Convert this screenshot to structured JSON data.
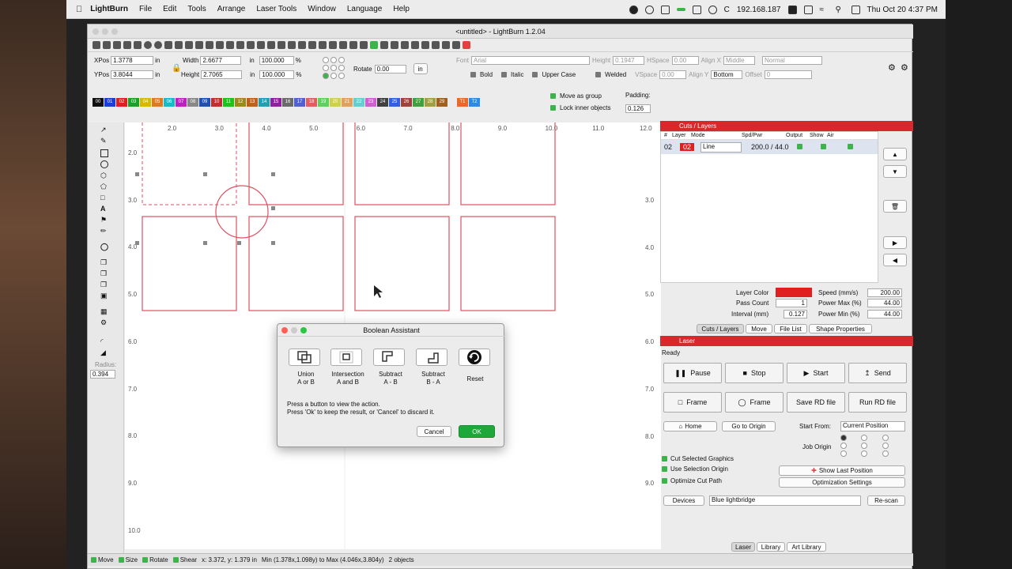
{
  "menubar": {
    "app": "LightBurn",
    "menus": [
      "File",
      "Edit",
      "Tools",
      "Arrange",
      "Laser Tools",
      "Window",
      "Language",
      "Help"
    ],
    "ip": "192.168.187",
    "clock": "Thu Oct 20  4:37 PM"
  },
  "window": {
    "title": "<untitled> - LightBurn 1.2.04"
  },
  "props": {
    "xpos_label": "XPos",
    "xpos": "1.3778",
    "ypos_label": "YPos",
    "ypos": "3.8044",
    "unit": "in",
    "width_label": "Width",
    "width": "2.6677",
    "height_label": "Height",
    "height": "2.7065",
    "scale_w": "100.000",
    "scale_h": "100.000",
    "pct": "%",
    "rotate_label": "Rotate",
    "rotate": "0.00",
    "in_btn": "in"
  },
  "font": {
    "font_label": "Font",
    "font": "Arial",
    "height_label": "Height",
    "height": "0.1947",
    "hspace_label": "HSpace",
    "hspace": "0.00",
    "alignx_label": "Align X",
    "alignx": "Middle",
    "normal": "Normal",
    "bold": "Bold",
    "italic": "Italic",
    "upper": "Upper Case",
    "welded": "Welded",
    "vspace_label": "VSpace",
    "vspace": "0.00",
    "aligny_label": "Align Y",
    "aligny": "Bottom",
    "offset_label": "Offset",
    "offset": "0"
  },
  "palette": [
    "00",
    "01",
    "02",
    "03",
    "04",
    "05",
    "06",
    "07",
    "08",
    "09",
    "10",
    "11",
    "12",
    "13",
    "14",
    "15",
    "16",
    "17",
    "18",
    "19",
    "20",
    "21",
    "22",
    "23",
    "24",
    "25",
    "26",
    "27",
    "28",
    "29"
  ],
  "palette_colors": [
    "#111",
    "#1a3fd6",
    "#e02020",
    "#1aa12a",
    "#d8b800",
    "#e07a20",
    "#1ab8c8",
    "#c020c0",
    "#888",
    "#2050b0",
    "#c03030",
    "#20c020",
    "#9a8a20",
    "#c06020",
    "#20a0b0",
    "#9020a0",
    "#6a6a6a",
    "#5060d0",
    "#e06060",
    "#60d060",
    "#d0d050",
    "#e0a060",
    "#60d0d0",
    "#d060d0",
    "#404040",
    "#3060e0",
    "#a04040",
    "#40a040",
    "#a0a040",
    "#a06020"
  ],
  "palette_tail": [
    "T1",
    "T2"
  ],
  "palette_tail_colors": [
    "#e86a2a",
    "#2a8ae8"
  ],
  "group": {
    "move": "Move as group",
    "lock": "Lock inner objects",
    "padding_label": "Padding:",
    "padding": "0.126"
  },
  "canvas": {
    "top_ticks": [
      "2.0",
      "3.0",
      "4.0",
      "5.0",
      "6.0",
      "7.0",
      "8.0",
      "9.0",
      "10.0",
      "11.0",
      "12.0"
    ],
    "left_ticks": [
      "2.0",
      "3.0",
      "4.0",
      "5.0",
      "6.0",
      "7.0",
      "8.0",
      "9.0",
      "10.0"
    ],
    "right_ticks": [
      "3.0",
      "4.0",
      "5.0",
      "6.0",
      "7.0",
      "8.0",
      "9.0"
    ],
    "radius_label": "Radius:",
    "radius": "0.394"
  },
  "status": {
    "move": "Move",
    "size": "Size",
    "rotate": "Rotate",
    "shear": "Shear",
    "coords": "x: 3.372, y: 1.379 in",
    "minmax": "Min (1.378x,1.098y) to Max (4.046x,3.804y)",
    "count": "2 objects"
  },
  "cuts": {
    "title": "Cuts / Layers",
    "headers": [
      "#",
      "Layer",
      "Mode",
      "Spd/Pwr",
      "Output",
      "Show",
      "Air"
    ],
    "row": {
      "num": "02",
      "layer": "02",
      "mode": "Line",
      "spdpwr": "200.0 / 44.0"
    },
    "layer_color": "Layer Color",
    "speed_label": "Speed (mm/s)",
    "speed": "200.00",
    "pass_label": "Pass Count",
    "pass": "1",
    "pmax_label": "Power Max (%)",
    "pmax": "44.00",
    "interval_label": "Interval (mm)",
    "interval": "0.127",
    "pmin_label": "Power Min (%)",
    "pmin": "44.00"
  },
  "tabs1": [
    "Cuts / Layers",
    "Move",
    "File List",
    "Shape Properties"
  ],
  "laser": {
    "title": "Laser",
    "state": "Ready",
    "pause": "Pause",
    "stop": "Stop",
    "start": "Start",
    "send": "Send",
    "frame1": "Frame",
    "frame2": "Frame",
    "save_rd": "Save RD file",
    "run_rd": "Run RD file",
    "home": "Home",
    "goto_origin": "Go to Origin",
    "start_from_label": "Start From:",
    "start_from": "Current Position",
    "job_origin": "Job Origin",
    "cut_selected": "Cut Selected Graphics",
    "use_selection": "Use Selection Origin",
    "optimize": "Optimize Cut Path",
    "show_last": "Show Last Position",
    "opt_settings": "Optimization Settings",
    "devices": "Devices",
    "device": "Blue lightbridge",
    "rescan": "Re-scan"
  },
  "tabs2": [
    "Laser",
    "Library",
    "Art Library"
  ],
  "dialog": {
    "title": "Boolean Assistant",
    "b1a": "Union",
    "b1b": "A or B",
    "b2a": "Intersection",
    "b2b": "A and B",
    "b3a": "Subtract",
    "b3b": "A - B",
    "b4a": "Subtract",
    "b4b": "B - A",
    "b5": "Reset",
    "msg1": "Press a button to view the action.",
    "msg2": "Press 'Ok' to keep the result, or 'Cancel' to discard it.",
    "cancel": "Cancel",
    "ok": "OK"
  }
}
